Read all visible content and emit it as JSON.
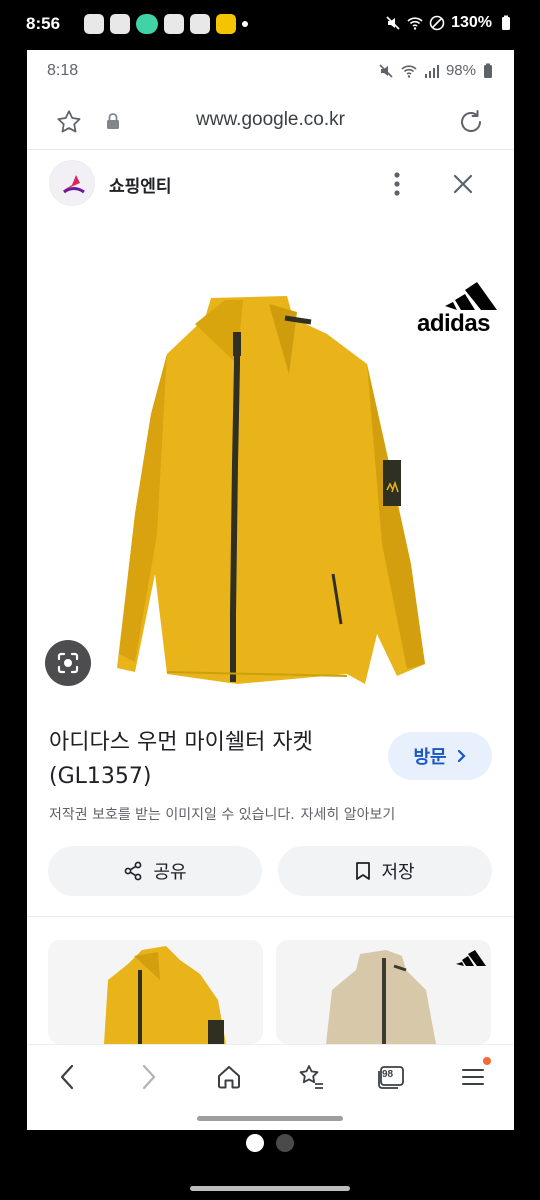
{
  "outer_status": {
    "time": "8:56",
    "right_text": "130%"
  },
  "inner_status": {
    "time": "8:18",
    "battery": "98%"
  },
  "browser": {
    "url": "www.google.co.kr"
  },
  "source": {
    "name": "쇼핑엔티"
  },
  "brand": {
    "logo_text": "adidas"
  },
  "product": {
    "title_line1": "아디다스 우먼 마이쉘터 자켓",
    "title_line2": "(GL1357)",
    "visit_label": "방문",
    "copyright_notice": "저작권 보호를 받는 이미지일 수 있습니다.",
    "learn_more": "자세히 알아보기",
    "jacket_color": "#e9b419"
  },
  "actions": {
    "share_label": "공유",
    "save_label": "저장"
  },
  "bottom_nav": {
    "tabs_count": "98"
  },
  "colors": {
    "accent": "#1a56c4",
    "visit_bg": "#e8f0fe",
    "notification_badge": "#f26b3a"
  }
}
